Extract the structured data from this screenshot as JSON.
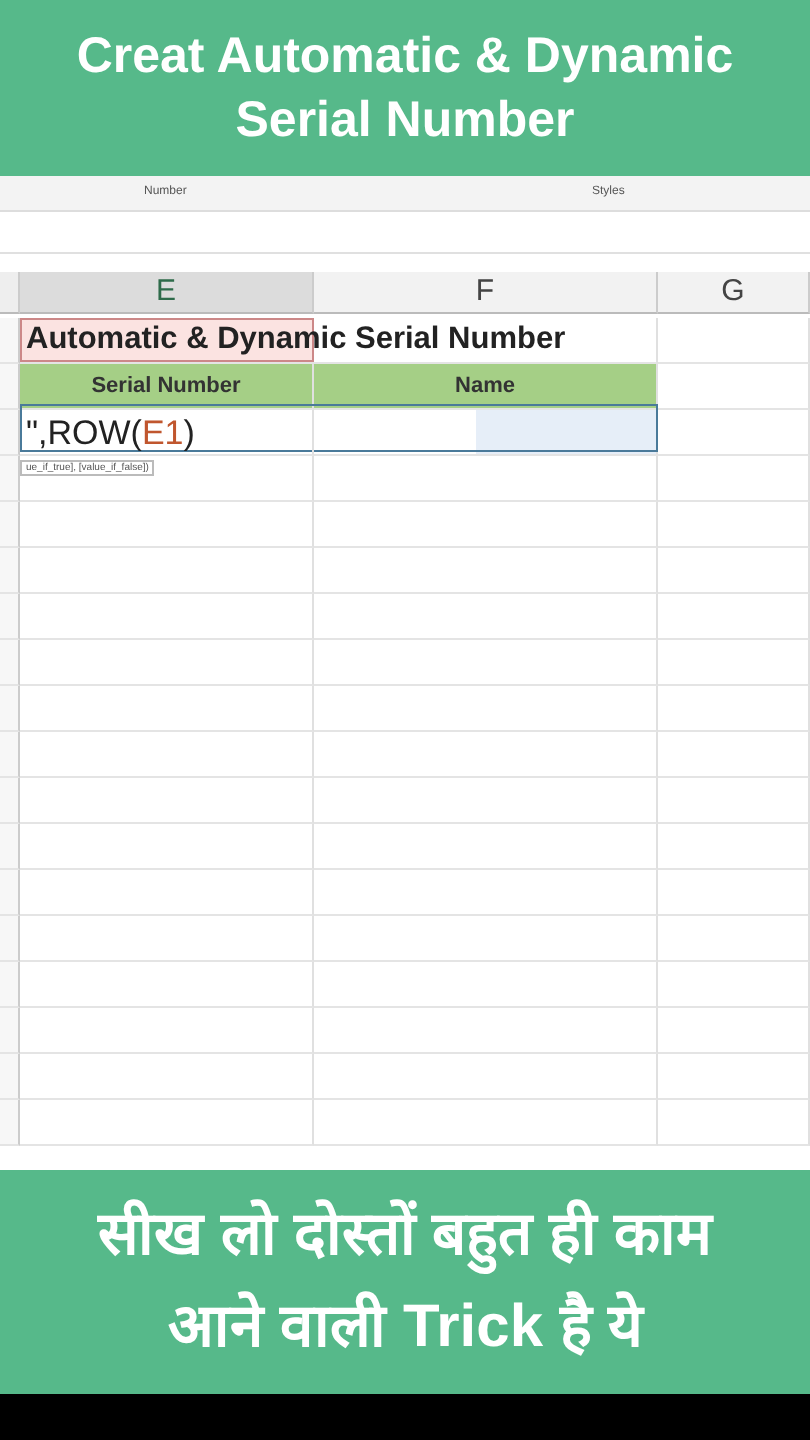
{
  "top_banner": {
    "lines": [
      "Creat Automatic & Dynamic",
      "Serial Number"
    ]
  },
  "ribbon": {
    "groups": [
      "Number",
      "Styles"
    ]
  },
  "columns": [
    {
      "label": "E",
      "selected": true
    },
    {
      "label": "F",
      "selected": false
    },
    {
      "label": "G",
      "selected": false
    }
  ],
  "sheet": {
    "title": "Automatic & Dynamic Serial Number",
    "headers": [
      "Serial Number",
      "Name"
    ],
    "formula_parts": [
      {
        "text": "\",ROW(",
        "kind": "plain"
      },
      {
        "text": "E1",
        "kind": "ref"
      },
      {
        "text": ")",
        "kind": "plain"
      }
    ],
    "tooltip": "ue_if_true], [value_if_false])"
  },
  "bottom_banner": {
    "lines": [
      "सीख लो दोस्तों बहुत ही काम",
      "आने वाली Trick है ये"
    ]
  }
}
